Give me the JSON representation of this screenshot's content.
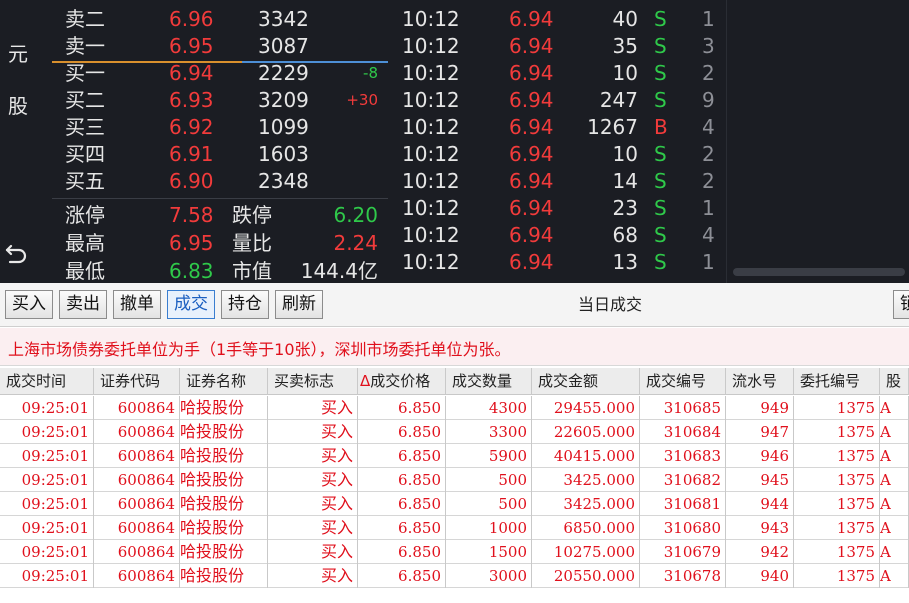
{
  "side": {
    "char1": "元",
    "char2": "股"
  },
  "book": {
    "rows": [
      {
        "label": "卖二",
        "price": "6.96",
        "volume": "3342",
        "change": "",
        "pclass": "red",
        "cclass": ""
      },
      {
        "label": "卖一",
        "price": "6.95",
        "volume": "3087",
        "change": "",
        "pclass": "red",
        "cclass": ""
      },
      {
        "label": "买一",
        "price": "6.94",
        "volume": "2229",
        "change": "-8",
        "pclass": "red",
        "cclass": "grn"
      },
      {
        "label": "买二",
        "price": "6.93",
        "volume": "3209",
        "change": "+30",
        "pclass": "red",
        "cclass": "red"
      },
      {
        "label": "买三",
        "price": "6.92",
        "volume": "1099",
        "change": "",
        "pclass": "red",
        "cclass": ""
      },
      {
        "label": "买四",
        "price": "6.91",
        "volume": "1603",
        "change": "",
        "pclass": "red",
        "cclass": ""
      },
      {
        "label": "买五",
        "price": "6.90",
        "volume": "2348",
        "change": "",
        "pclass": "red",
        "cclass": ""
      }
    ],
    "stats": [
      {
        "label": "涨停",
        "value": "7.58",
        "vclass": "red",
        "label2": "跌停",
        "value2": "6.20",
        "v2class": "grn"
      },
      {
        "label": "最高",
        "value": "6.95",
        "vclass": "red",
        "label2": "量比",
        "value2": "2.24",
        "v2class": "red"
      },
      {
        "label": "最低",
        "value": "6.83",
        "vclass": "grn",
        "label2": "市值",
        "value2": "144.4亿",
        "v2class": "wht"
      }
    ]
  },
  "ticks": [
    {
      "time": "10:12",
      "price": "6.94",
      "volume": "40",
      "flag": "S",
      "count": "1",
      "vclass": "",
      "fclass": "grn"
    },
    {
      "time": "10:12",
      "price": "6.94",
      "volume": "35",
      "flag": "S",
      "count": "3",
      "vclass": "",
      "fclass": "grn"
    },
    {
      "time": "10:12",
      "price": "6.94",
      "volume": "10",
      "flag": "S",
      "count": "2",
      "vclass": "",
      "fclass": "grn"
    },
    {
      "time": "10:12",
      "price": "6.94",
      "volume": "247",
      "flag": "S",
      "count": "9",
      "vclass": "",
      "fclass": "grn"
    },
    {
      "time": "10:12",
      "price": "6.94",
      "volume": "1267",
      "flag": "B",
      "count": "4",
      "vclass": "mag",
      "fclass": "red"
    },
    {
      "time": "10:12",
      "price": "6.94",
      "volume": "10",
      "flag": "S",
      "count": "2",
      "vclass": "",
      "fclass": "grn"
    },
    {
      "time": "10:12",
      "price": "6.94",
      "volume": "14",
      "flag": "S",
      "count": "2",
      "vclass": "",
      "fclass": "grn"
    },
    {
      "time": "10:12",
      "price": "6.94",
      "volume": "23",
      "flag": "S",
      "count": "1",
      "vclass": "",
      "fclass": "grn"
    },
    {
      "time": "10:12",
      "price": "6.94",
      "volume": "68",
      "flag": "S",
      "count": "4",
      "vclass": "",
      "fclass": "grn"
    },
    {
      "time": "10:12",
      "price": "6.94",
      "volume": "13",
      "flag": "S",
      "count": "1",
      "vclass": "",
      "fclass": "grn"
    }
  ],
  "toolbar": {
    "buttons": [
      "买入",
      "卖出",
      "撤单",
      "成交",
      "持仓",
      "刷新"
    ],
    "active_index": 3,
    "title": "当日成交",
    "edge_button": "锁"
  },
  "notice": "上海市场债券委托单位为手（1手等于10张），深圳市场委托单位为张。",
  "table": {
    "headers": [
      "成交时间",
      "证券代码",
      "证券名称",
      "买卖标志",
      "成交价格",
      "成交数量",
      "成交金额",
      "成交编号",
      "流水号",
      "委托编号",
      "股"
    ],
    "sort_marker": "Δ",
    "rows": [
      [
        "09:25:01",
        "600864",
        "哈投股份",
        "买入",
        "6.850",
        "4300",
        "29455.000",
        "310685",
        "949",
        "1375",
        "A"
      ],
      [
        "09:25:01",
        "600864",
        "哈投股份",
        "买入",
        "6.850",
        "3300",
        "22605.000",
        "310684",
        "947",
        "1375",
        "A"
      ],
      [
        "09:25:01",
        "600864",
        "哈投股份",
        "买入",
        "6.850",
        "5900",
        "40415.000",
        "310683",
        "946",
        "1375",
        "A"
      ],
      [
        "09:25:01",
        "600864",
        "哈投股份",
        "买入",
        "6.850",
        "500",
        "3425.000",
        "310682",
        "945",
        "1375",
        "A"
      ],
      [
        "09:25:01",
        "600864",
        "哈投股份",
        "买入",
        "6.850",
        "500",
        "3425.000",
        "310681",
        "944",
        "1375",
        "A"
      ],
      [
        "09:25:01",
        "600864",
        "哈投股份",
        "买入",
        "6.850",
        "1000",
        "6850.000",
        "310680",
        "943",
        "1375",
        "A"
      ],
      [
        "09:25:01",
        "600864",
        "哈投股份",
        "买入",
        "6.850",
        "1500",
        "10275.000",
        "310679",
        "942",
        "1375",
        "A"
      ],
      [
        "09:25:01",
        "600864",
        "哈投股份",
        "买入",
        "6.850",
        "3000",
        "20550.000",
        "310678",
        "940",
        "1375",
        "A"
      ]
    ]
  },
  "colors": {
    "up": "#f23b3b",
    "down": "#2fc94a",
    "accent": "#3a7ed0",
    "panel": "#1b1d23"
  }
}
